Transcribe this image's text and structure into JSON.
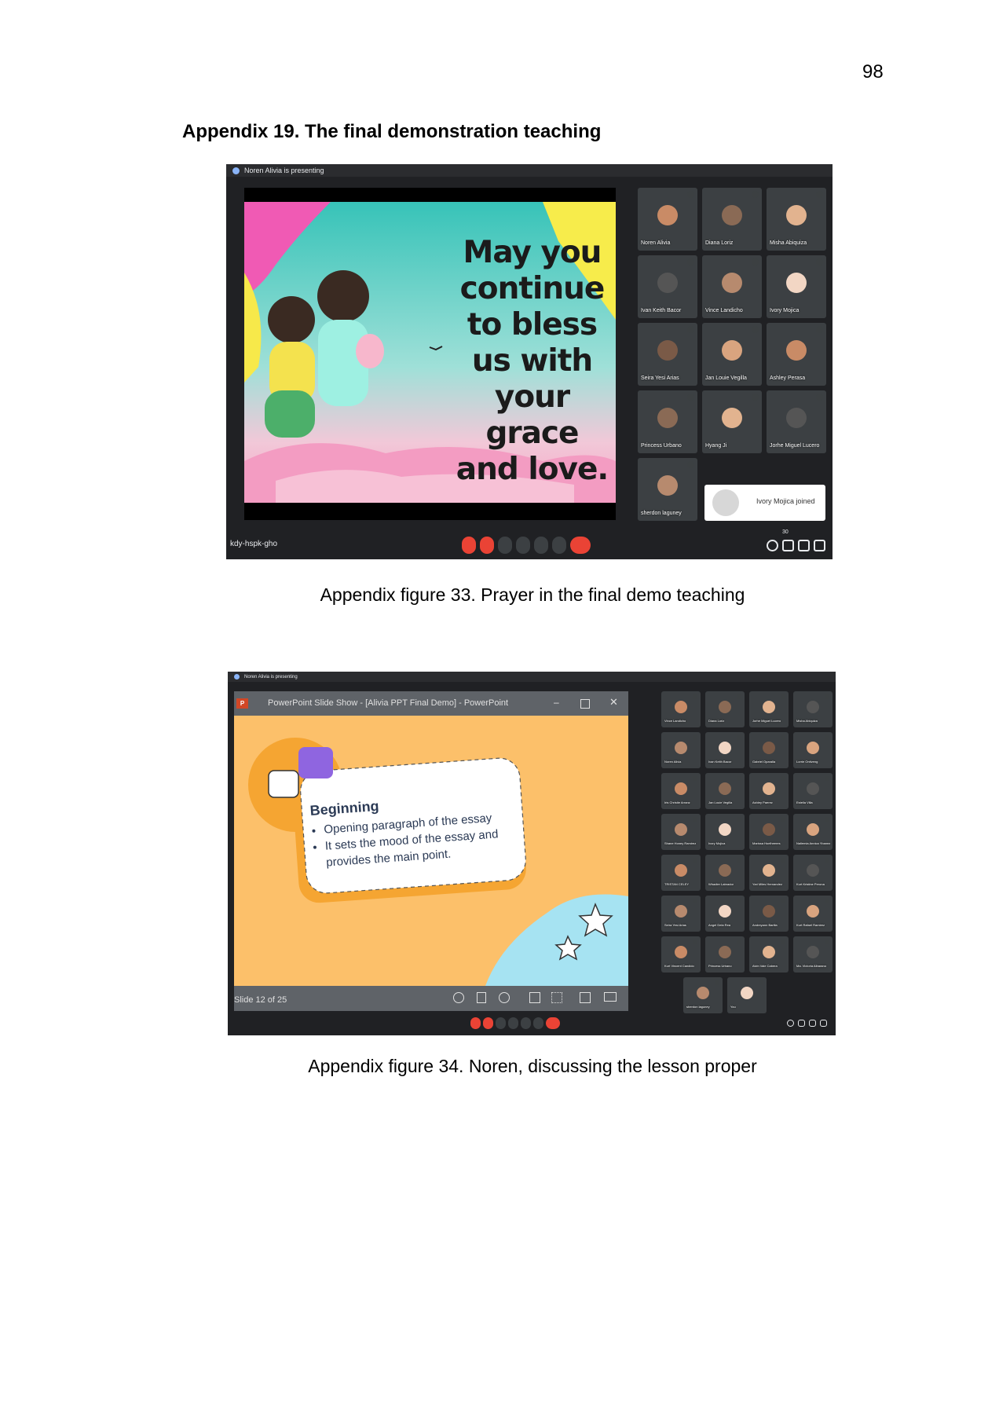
{
  "page_number": "98",
  "heading": "Appendix 19. The final demonstration teaching",
  "figures": [
    {
      "caption": "Appendix figure 33. Prayer in the final demo teaching",
      "meet": {
        "presenting_label": "Noren Alivia is presenting",
        "meeting_code": "kdy-hspk-gho",
        "toast": "Ivory Mojica joined",
        "participant_count": "30",
        "slide_text": "May you continue to bless us with your grace and love.",
        "participants": [
          "Noren Alivia",
          "Diana Loriz",
          "Misha Abiquiza",
          "Ivan Keith Bacor",
          "Vince Landicho",
          "Ivory Mojica",
          "Seira Yesi Arias",
          "Jan Louie Vegilla",
          "Ashley Perasa",
          "Princess Urbano",
          "Hyang Ji",
          "Jorhe Miguel Lucero",
          "sherdon laguney"
        ]
      }
    },
    {
      "caption": "Appendix figure 34. Noren, discussing the lesson proper",
      "meet": {
        "presenting_label": "Noren Alivia is presenting",
        "ppt_title": "PowerPoint Slide Show - [Alivia PPT Final Demo] - PowerPoint",
        "slide_heading": "Beginning",
        "slide_bullets": [
          "Opening paragraph of the essay",
          "It sets the mood of the essay and provides the main point."
        ],
        "slide_counter": "Slide 12 of 25",
        "participants": [
          "Vince Landicho",
          "Diana Loriz",
          "Jorhe Miguel Lucero",
          "Misha Abiquiza",
          "Noren Alivia",
          "Ivan Keith Bacor",
          "Gabriel Oparalla",
          "Lorrie Ontiveng",
          "Iris Christie Arranz",
          "Jan Louie Vegilla",
          "Ashley Paerez",
          "Estella Villa",
          "Shane Honey Ramirez",
          "Ivory Mojica",
          "Marissa Hoelheeres",
          "Naliemia Annica Ybanez",
          "TRISTAN CELEY",
          "Whadier Labrador",
          "Yari Miles Hernandez",
          "Kurt Kristine Perona",
          "Seira Yesi Arias",
          "Angel Dela Rea",
          "Andreyann Barilla",
          "Kurt Rafael Ramirez",
          "Kurt Vincent Candido",
          "Princess Urbano",
          "Alvin Vale Cabera",
          "Ma. Victoria Albarano",
          "sherdon laguney",
          "You"
        ]
      }
    }
  ],
  "colors": {
    "meet_bg": "#202124",
    "tile_bg": "#3c4043",
    "end_call": "#ea4335",
    "ppt_bg": "#fcc06a",
    "ppt_accent": "#f5a532",
    "ppt_purple": "#8f65e0",
    "ppt_cyan": "#a6e3f2"
  }
}
